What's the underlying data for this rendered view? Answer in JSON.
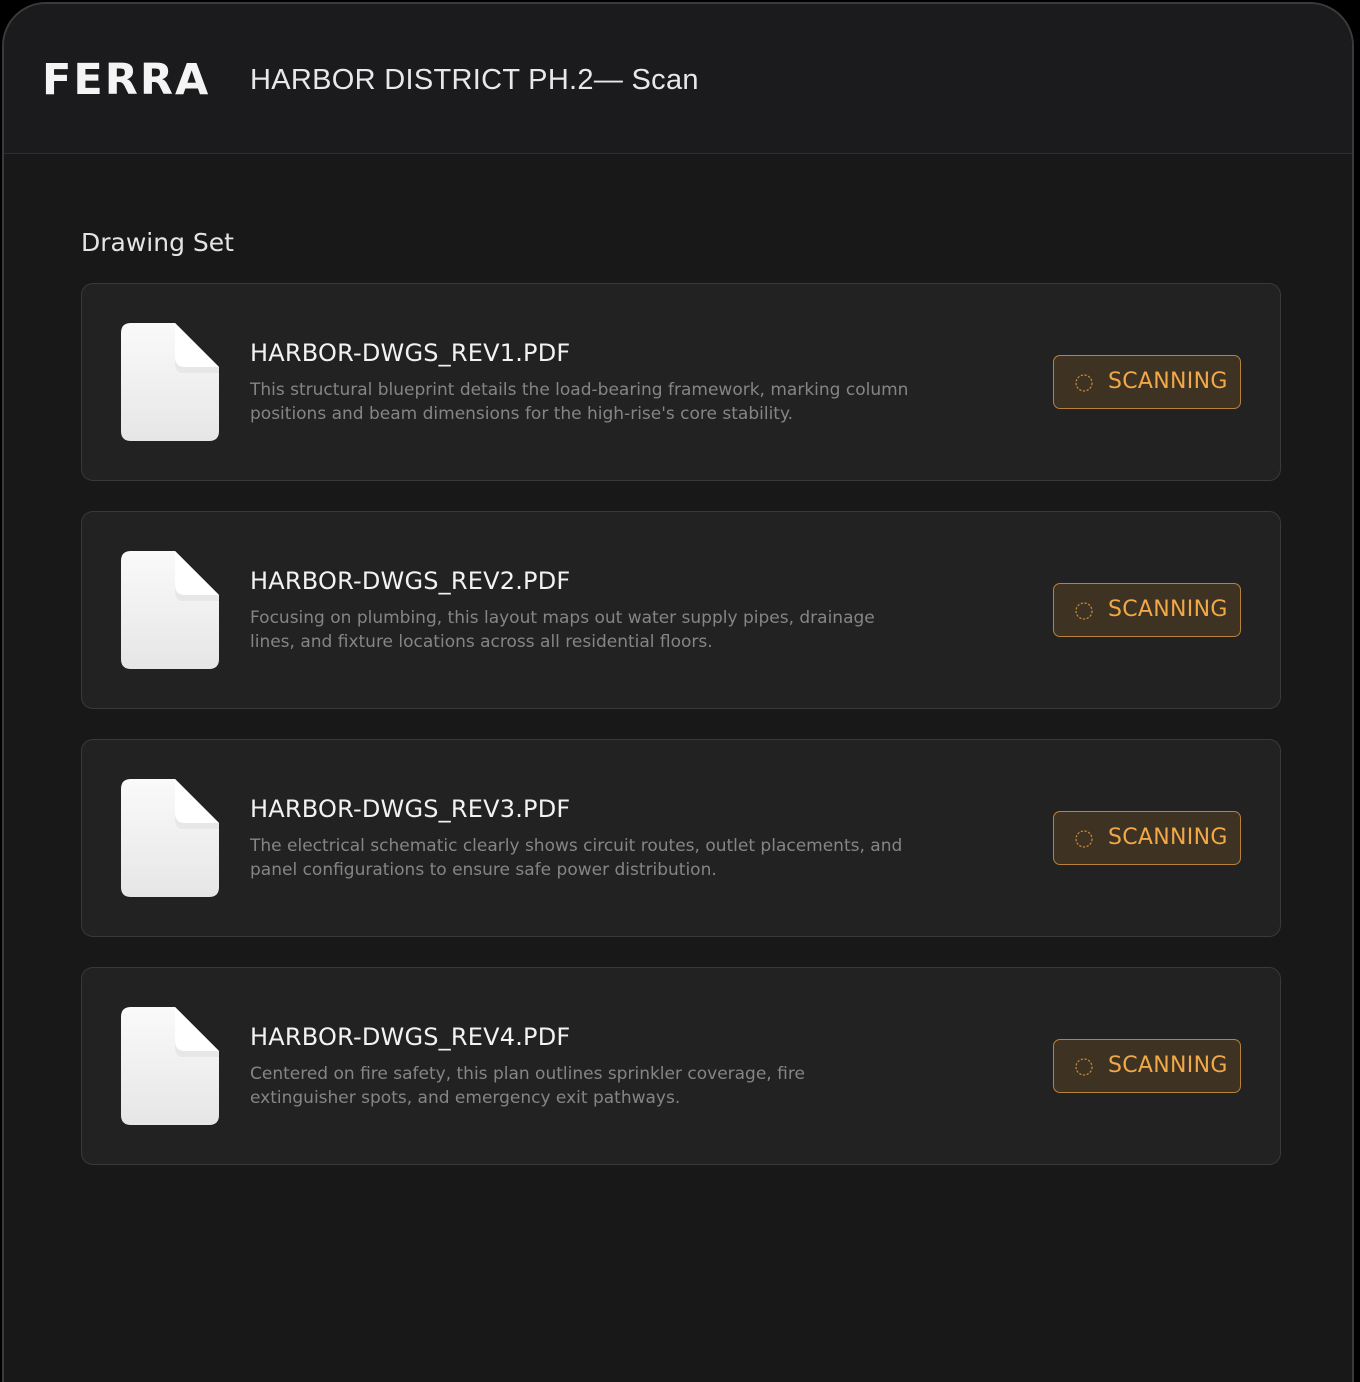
{
  "header": {
    "logo": "FERRA",
    "title": "HARBOR DISTRICT PH.2— Scan"
  },
  "section": {
    "title": "Drawing Set"
  },
  "files": [
    {
      "name": "HARBOR-DWGS_REV1.PDF",
      "description": "This structural blueprint details the load-bearing framework, marking column positions and beam dimensions for the high-rise's core stability.",
      "status": "SCANNING",
      "icon": "document-icon"
    },
    {
      "name": "HARBOR-DWGS_REV2.PDF",
      "description": "Focusing on plumbing, this layout maps out water supply pipes, drainage lines, and fixture locations across all residential floors.",
      "status": "SCANNING",
      "icon": "document-icon"
    },
    {
      "name": "HARBOR-DWGS_REV3.PDF",
      "description": "The electrical schematic clearly shows circuit routes, outlet placements, and panel configurations to ensure safe power distribution.",
      "status": "SCANNING",
      "icon": "document-icon"
    },
    {
      "name": "HARBOR-DWGS_REV4.PDF",
      "description": "Centered on fire safety, this plan outlines sprinkler coverage, fire extinguisher spots, and emergency exit pathways.",
      "status": "SCANNING",
      "icon": "document-icon"
    }
  ],
  "colors": {
    "background": "#181819",
    "card": "#222223",
    "accent": "#f0a848",
    "badge_bg": "#3e3222",
    "badge_border": "#b8823a"
  }
}
